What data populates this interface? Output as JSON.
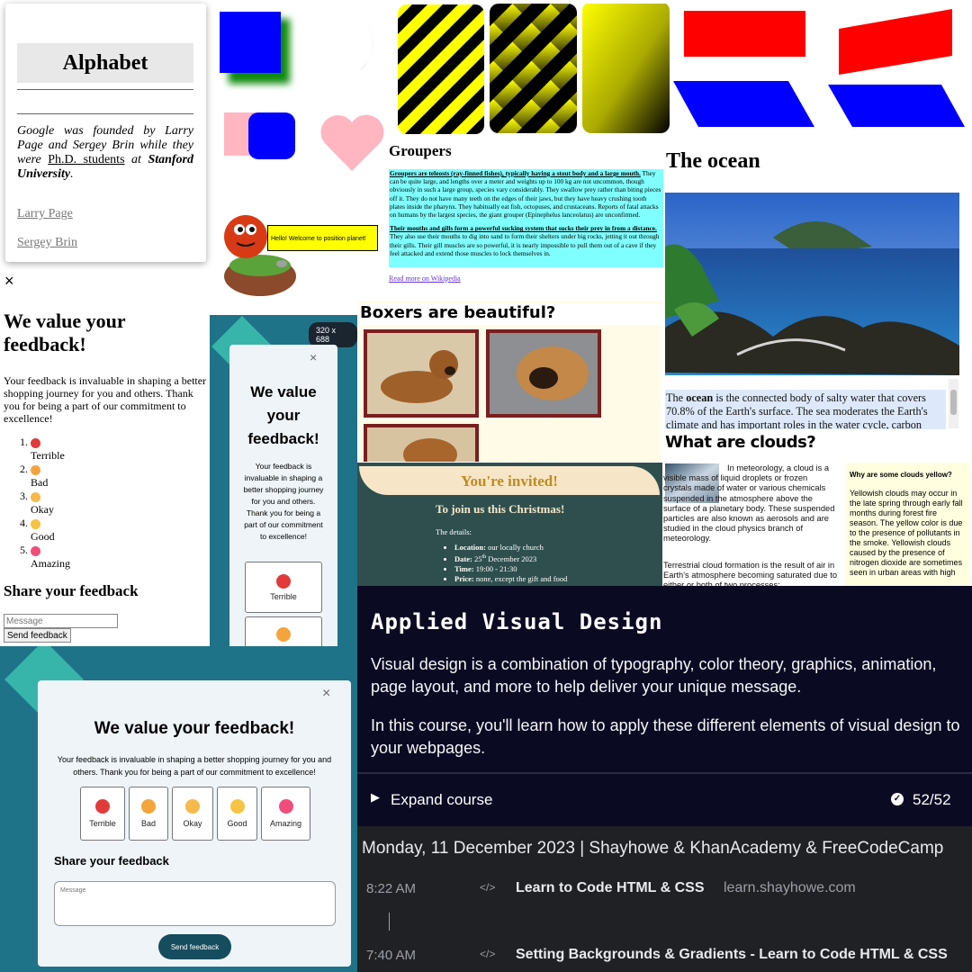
{
  "alphabet": {
    "title": "Alphabet",
    "text_pre": "Google was founded by Larry Page and Sergey Brin while they were",
    "text_link": "Ph.D. students",
    "text_mid": "at",
    "text_bold": "Stanford University",
    "text_end": ".",
    "links": [
      "Larry Page",
      "Sergey Brin"
    ]
  },
  "tooltip": {
    "text": "Hello! Welcome to position planet!"
  },
  "groupers": {
    "title": "Groupers",
    "p1_bold": "Groupers are teleosts (ray-finned fishes), typically having a stout body and a large mouth.",
    "p1_rest": "They can be quite large, and lengths over a meter and weights up to 100 kg are not uncommon, though obviously in such a large group, species vary considerably. They swallow prey rather than biting pieces off it. They do not have many teeth on the edges of their jaws, but they have heavy crushing tooth plates inside the pharynx. They habitually eat fish, octopuses, and crustaceans. Reports of fatal attacks on humans by the largest species, the giant grouper (Epinephelus lanceolatus) are unconfirmed.",
    "p2_bold": "Their mouths and gills form a powerful sucking system that sucks their prey in from a distance.",
    "p2_rest": "They also use their mouths to dig into sand to form their shelters under big rocks, jetting it out through their gills. Their gill muscles are so powerful, it is nearly impossible to pull them out of a cave if they feel attacked and extend those muscles to lock themselves in.",
    "link": "Read more on Wikipedia"
  },
  "ocean": {
    "title": "The ocean",
    "cap_pre": "The",
    "cap_bold": "ocean",
    "cap_rest": "is the connected body of salty water that covers 70.8% of the Earth's surface. The sea moderates the Earth's climate and has important roles in the water cycle, carbon"
  },
  "boxers": {
    "title": "Boxers are beautiful?"
  },
  "feedback_plain": {
    "close": "×",
    "title": "We value your feedback!",
    "desc": "Your feedback is invaluable in shaping a better shopping journey for you and others. Thank you for being a part of our commitment to excellence!",
    "ratings": [
      "Terrible",
      "Bad",
      "Okay",
      "Good",
      "Amazing"
    ],
    "share_title": "Share your feedback",
    "message_placeholder": "Message",
    "send": "Send feedback"
  },
  "feedback_mobile": {
    "size_badge": "320 x 688",
    "close": "×",
    "title": "We value your feedback!",
    "desc": "Your feedback is invaluable in shaping a better shopping journey for you and others. Thank you for being a part of our commitment to excellence!",
    "ratings": [
      "Terrible"
    ]
  },
  "feedback_desktop": {
    "close": "×",
    "title": "We value your feedback!",
    "desc": "Your feedback is invaluable in shaping a better shopping journey for you and others. Thank you for being a part of our commitment to excellence!",
    "ratings": [
      "Terrible",
      "Bad",
      "Okay",
      "Good",
      "Amazing"
    ],
    "share_title": "Share your feedback",
    "message_placeholder": "Message",
    "send": "Send feedback"
  },
  "invite": {
    "banner": "You're invited!",
    "heading": "To join us this Christmas!",
    "details_label": "The details:",
    "items": [
      {
        "label": "Location:",
        "value": "our locally church"
      },
      {
        "label": "Date:",
        "value": "25",
        "sup": "th",
        "after": "December 2023"
      },
      {
        "label": "Time:",
        "value": "19:00 - 21:30"
      },
      {
        "label": "Price:",
        "value": "none, except the gift and food"
      }
    ]
  },
  "clouds": {
    "title": "What are clouds?",
    "intro": "In meteorology, a cloud is a visible mass of liquid droplets or frozen crystals made of water or various chemicals suspended in the atmosphere above the surface of a planetary body. These suspended particles are also known as aerosols and are studied in the cloud physics branch of meteorology.",
    "p2": "Terrestrial cloud formation is the result of air in Earth's atmosphere becoming saturated due to either or both of two processes:",
    "side_title": "Why are some clouds yellow?",
    "side_text": "Yellowish clouds may occur in the late spring through early fall months during forest fire season. The yellow color is due to the presence of pollutants in the smoke. Yellowish clouds caused by the presence of nitrogen dioxide are sometimes seen in urban areas with high"
  },
  "course": {
    "title": "Applied Visual Design",
    "p1": "Visual design is a combination of typography, color theory, graphics, animation, page layout, and more to help deliver your unique message.",
    "p2": "In this course, you'll learn how to apply these different elements of visual design to your webpages.",
    "expand": "Expand course",
    "progress": "52/52"
  },
  "history": {
    "date_header": "Monday, 11 December 2023 | Shayhowe & KhanAcademy & FreeCodeCamp",
    "entries": [
      {
        "time": "8:22 AM",
        "title": "Learn to Code HTML & CSS",
        "domain": "learn.shayhowe.com"
      },
      {
        "time": "7:40 AM",
        "title": "Setting Backgrounds & Gradients - Learn to Code HTML & CSS",
        "domain": ""
      }
    ]
  },
  "colors": {
    "blue": "#0000ff",
    "green": "#008000",
    "pink": "#ffb6c1",
    "red": "#ff0000",
    "yellow": "#ffff00",
    "teal_bg": "#1f7388",
    "course_bg": "#0a0a23",
    "history_bg": "#202124",
    "invite_bg": "#2f4f4f",
    "groupers_box": "#7fffff"
  }
}
